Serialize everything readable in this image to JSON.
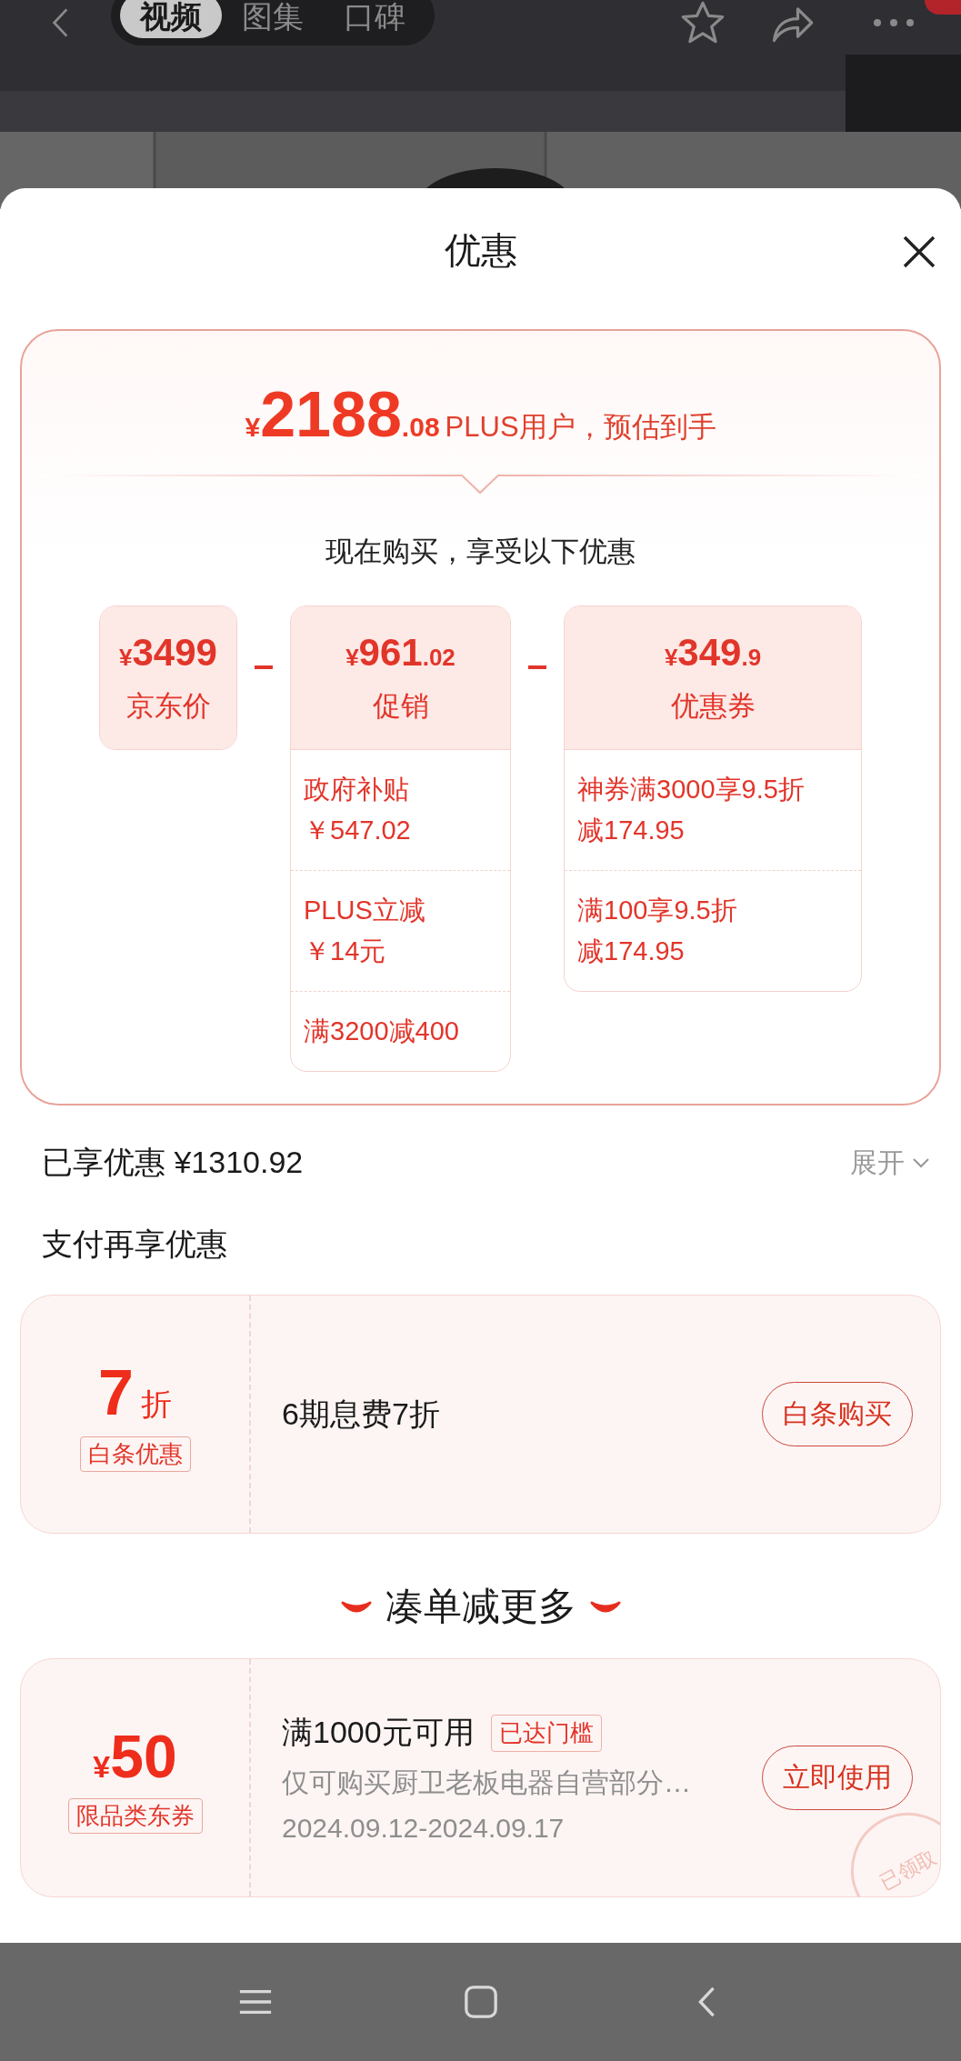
{
  "top_bar": {
    "tabs": [
      {
        "label": "视频",
        "selected": true
      },
      {
        "label": "图集",
        "selected": false
      },
      {
        "label": "口碑",
        "selected": false
      }
    ]
  },
  "sheet": {
    "title": "优惠"
  },
  "estimate": {
    "currency": "¥",
    "integer": "2188",
    "decimal": ".08",
    "note": "PLUS用户，预估到手"
  },
  "subtitle": "现在购买，享受以下优惠",
  "breakdown": [
    {
      "currency": "¥",
      "integer": "3499",
      "label": "京东价"
    },
    {
      "currency": "¥",
      "integer": "961",
      "decimal": ".02",
      "label": "促销",
      "items": [
        {
          "lines": [
            "政府补贴",
            "￥547.02"
          ]
        },
        {
          "lines": [
            "PLUS立减",
            "￥14元"
          ]
        },
        {
          "lines": [
            "满3200减400"
          ]
        }
      ]
    },
    {
      "currency": "¥",
      "integer": "349",
      "decimal": ".9",
      "label": "优惠券",
      "items": [
        {
          "lines": [
            "神券满3000享9.5折",
            "减174.95"
          ]
        },
        {
          "lines": [
            "满100享9.5折",
            "减174.95"
          ]
        }
      ]
    }
  ],
  "saved": {
    "label": "已享优惠 ¥1310.92",
    "toggle": "展开"
  },
  "pay_section": {
    "heading": "支付再享优惠",
    "offer": {
      "value": "7",
      "unit": "折",
      "tag": "白条优惠",
      "description": "6期息费7折",
      "button": "白条购买"
    }
  },
  "more_section": {
    "heading": "凑单减更多",
    "coupons": [
      {
        "currency": "¥",
        "amount": "50",
        "tag": "限品类东券",
        "condition": "满1000元可用",
        "badge": "已达门槛",
        "scope": "仅可购买厨卫老板电器自营部分…",
        "validity": "2024.09.12-2024.09.17",
        "button": "立即使用",
        "stamp": "已领取"
      }
    ]
  }
}
